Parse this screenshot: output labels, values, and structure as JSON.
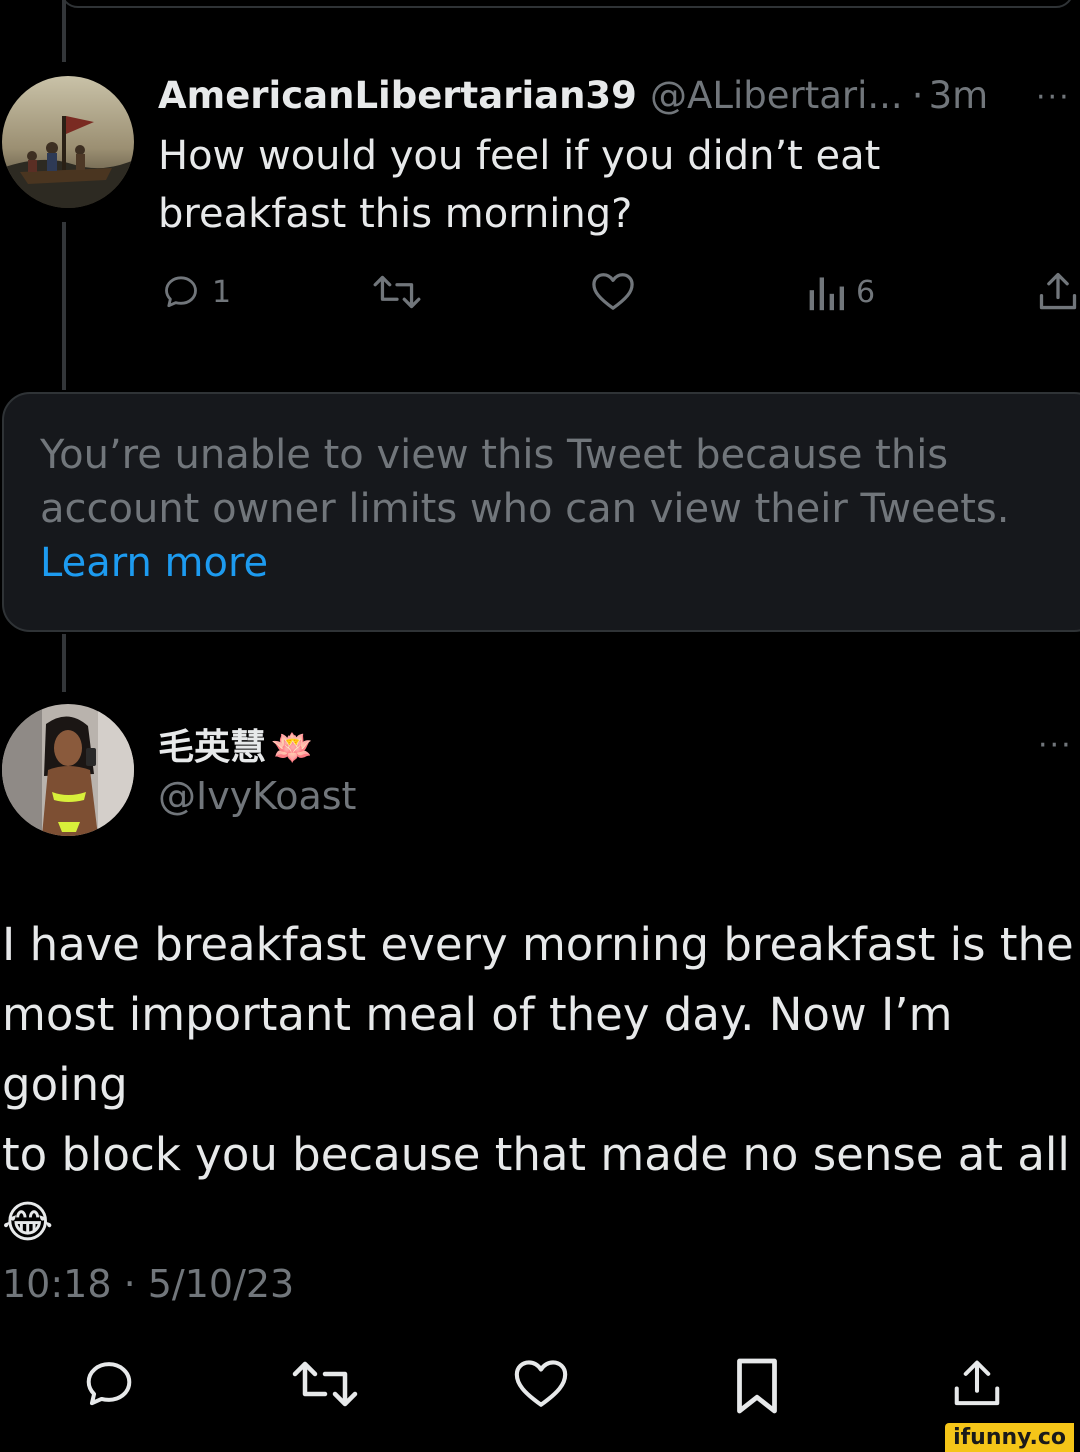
{
  "parent_tweet": {
    "display_name": "AmericanLibertarian39",
    "handle": "@ALibertari...",
    "separator": "·",
    "time": "3m",
    "more": "···",
    "text_line1": "How would you feel if you didn’t eat",
    "text_line2": "breakfast this morning?",
    "actions": {
      "reply_count": "1",
      "views_count": "6"
    }
  },
  "unavailable_notice": {
    "line1": "You’re unable to view this Tweet because this",
    "line2": "account owner limits who can view their Tweets.",
    "link": "Learn more"
  },
  "main_tweet": {
    "display_name": "毛英慧",
    "name_emoji": "🪷",
    "handle": "@IvyKoast",
    "more": "···",
    "text_line1": "I have breakfast every morning breakfast is the",
    "text_line2": "most important meal of they day. Now I’m going",
    "text_line3": "to block you because that made no sense at all",
    "text_emoji": "😂",
    "timestamp": "10:18 · 5/10/23"
  },
  "watermark": "ifunny.co",
  "colors": {
    "background": "#000000",
    "text_primary": "#e7e9ea",
    "text_muted": "#71767b",
    "link": "#1d9bf0",
    "notice_bg": "#16181c",
    "border": "#2f3336"
  }
}
